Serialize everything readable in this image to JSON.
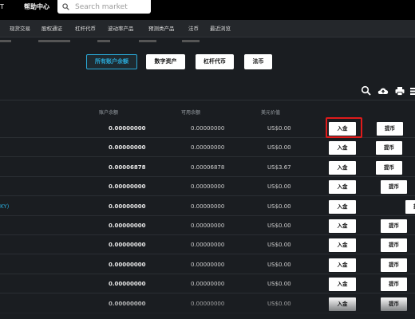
{
  "topbar": {
    "left_label": "T",
    "help_label": "帮助中心",
    "search_placeholder": "Search market"
  },
  "nav": {
    "items": [
      "现货交易",
      "股权通证",
      "杠杆代币",
      "波动率产品",
      "预测类产品",
      "法币",
      "最近浏览"
    ]
  },
  "filters": {
    "items": [
      "所有账户余额",
      "数字资产",
      "杠杆代币",
      "法币"
    ],
    "active": "所有账户余额"
  },
  "toolbar": {
    "icons": [
      "search-icon",
      "upload-icon",
      "print-icon",
      "menu-icon"
    ]
  },
  "table": {
    "headers": {
      "balance": "账户余额",
      "available": "可用余额",
      "usd": "美元价值"
    },
    "deposit_label": "入金",
    "withdraw_label": "提币",
    "rows": [
      {
        "name": "",
        "balance": "0.00000000",
        "available": "0.00000000",
        "usd": "US$0.00"
      },
      {
        "name": "",
        "balance": "0.00000000",
        "available": "0.00000000",
        "usd": "US$0.00"
      },
      {
        "name": "",
        "balance": "0.00006878",
        "available": "0.00006878",
        "usd": "US$3.67"
      },
      {
        "name": "",
        "balance": "0.00000000",
        "available": "0.00000000",
        "usd": "US$0.00"
      },
      {
        "name": "KY)",
        "balance": "0.00000000",
        "available": "0.00000000",
        "usd": "US$0.00"
      },
      {
        "name": "",
        "balance": "0.00000000",
        "available": "0.00000000",
        "usd": "US$0.00"
      },
      {
        "name": "",
        "balance": "0.00000000",
        "available": "0.00000000",
        "usd": "US$0.00"
      },
      {
        "name": "",
        "balance": "0.00000000",
        "available": "0.00000000",
        "usd": "US$0.00"
      },
      {
        "name": "",
        "balance": "0.00000000",
        "available": "0.00000000",
        "usd": "US$0.00"
      },
      {
        "name": "",
        "balance": "0.00000000",
        "available": "0.00000000",
        "usd": "US$0.00"
      }
    ]
  },
  "colors": {
    "accent": "#2aa8d6",
    "highlight": "#e01b1b",
    "background": "#1a1d21"
  }
}
